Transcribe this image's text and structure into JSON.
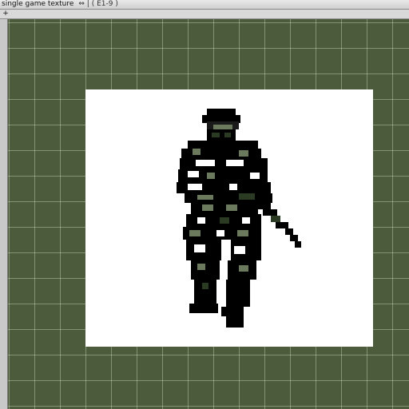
{
  "window": {
    "title": "single game texture",
    "meta": "⇔ | ( E1-9 )"
  },
  "toolbar": {
    "tool_glyph": "+"
  },
  "canvas": {
    "grid_color": "#c8d7b9",
    "background_color": "#4b5b3c",
    "texture_background": "#ffffff",
    "sprite_colors": [
      "#000000",
      "#2b3a22",
      "#6b7a5c",
      "#ffffff"
    ]
  }
}
